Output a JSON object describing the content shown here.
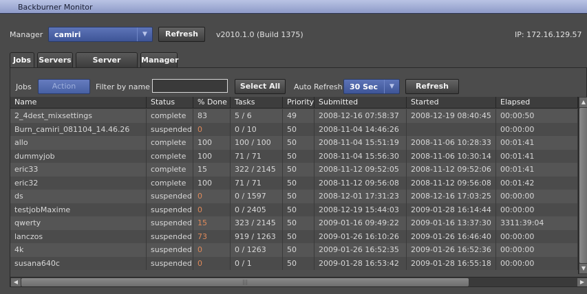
{
  "window": {
    "title": "Backburner Monitor"
  },
  "manager_bar": {
    "label": "Manager",
    "selected": "camiri",
    "refresh_label": "Refresh",
    "version": "v2010.1.0 (Build 1375)",
    "ip": "IP: 172.16.129.57"
  },
  "tabs": [
    {
      "label": "Jobs",
      "active": true
    },
    {
      "label": "Servers",
      "active": false
    },
    {
      "label": "Server Groups",
      "active": false
    },
    {
      "label": "Manager",
      "active": false
    }
  ],
  "jobs_toolbar": {
    "jobs_label": "Jobs",
    "action_label": "Action",
    "filter_label": "Filter by name",
    "filter_value": "",
    "select_all_label": "Select All",
    "auto_refresh_label": "Auto Refresh",
    "auto_refresh_value": "30 Sec",
    "refresh_label": "Refresh"
  },
  "table": {
    "columns": [
      "Name",
      "Status",
      "% Done",
      "Tasks",
      "Priority",
      "Submitted",
      "Started",
      "Elapsed"
    ],
    "rows": [
      [
        "2_4dest_mixsettings",
        "complete",
        "83",
        "5 / 6",
        "49",
        "2008-12-16 07:58:37",
        "2008-12-19 08:40:45",
        "00:00:50"
      ],
      [
        "Burn_camiri_081104_14.46.26",
        "suspended",
        "0",
        "0 / 10",
        "50",
        "2008-11-04 14:46:26",
        "",
        "00:00:00"
      ],
      [
        "allo",
        "complete",
        "100",
        "100 / 100",
        "50",
        "2008-11-04 15:51:19",
        "2008-11-06 10:28:33",
        "00:01:41"
      ],
      [
        "dummyjob",
        "complete",
        "100",
        "71 / 71",
        "50",
        "2008-11-04 15:56:30",
        "2008-11-06 10:30:14",
        "00:01:41"
      ],
      [
        "eric33",
        "complete",
        "15",
        "322 / 2145",
        "50",
        "2008-11-12 09:52:05",
        "2008-11-12 09:52:06",
        "00:01:41"
      ],
      [
        "eric32",
        "complete",
        "100",
        "71 / 71",
        "50",
        "2008-11-12 09:56:08",
        "2008-11-12 09:56:08",
        "00:01:42"
      ],
      [
        "ds",
        "suspended",
        "0",
        "0 / 1597",
        "50",
        "2008-12-01 17:31:23",
        "2008-12-16 17:03:25",
        "00:00:00"
      ],
      [
        "testjobMaxime",
        "suspended",
        "0",
        "0 / 2405",
        "50",
        "2008-12-19 15:44:03",
        "2009-01-28 16:14:44",
        "00:00:00"
      ],
      [
        "qwerty",
        "suspended",
        "15",
        "323 / 2145",
        "50",
        "2009-01-16 09:49:22",
        "2009-01-16 13:37:30",
        "3311:39:04"
      ],
      [
        "lanczos",
        "suspended",
        "73",
        "919 / 1263",
        "50",
        "2009-01-26 16:10:26",
        "2009-01-26 16:46:40",
        "00:00:00"
      ],
      [
        "4k",
        "suspended",
        "0",
        "0 / 1263",
        "50",
        "2009-01-26 16:52:35",
        "2009-01-26 16:52:36",
        "00:00:00"
      ],
      [
        "susana640c",
        "suspended",
        "0",
        "0 / 1",
        "50",
        "2009-01-28 16:53:42",
        "2009-01-28 16:55:18",
        "00:00:00"
      ]
    ]
  },
  "colors": {
    "accent": "#4f66a8",
    "suspended_value": "#e08a5a"
  }
}
